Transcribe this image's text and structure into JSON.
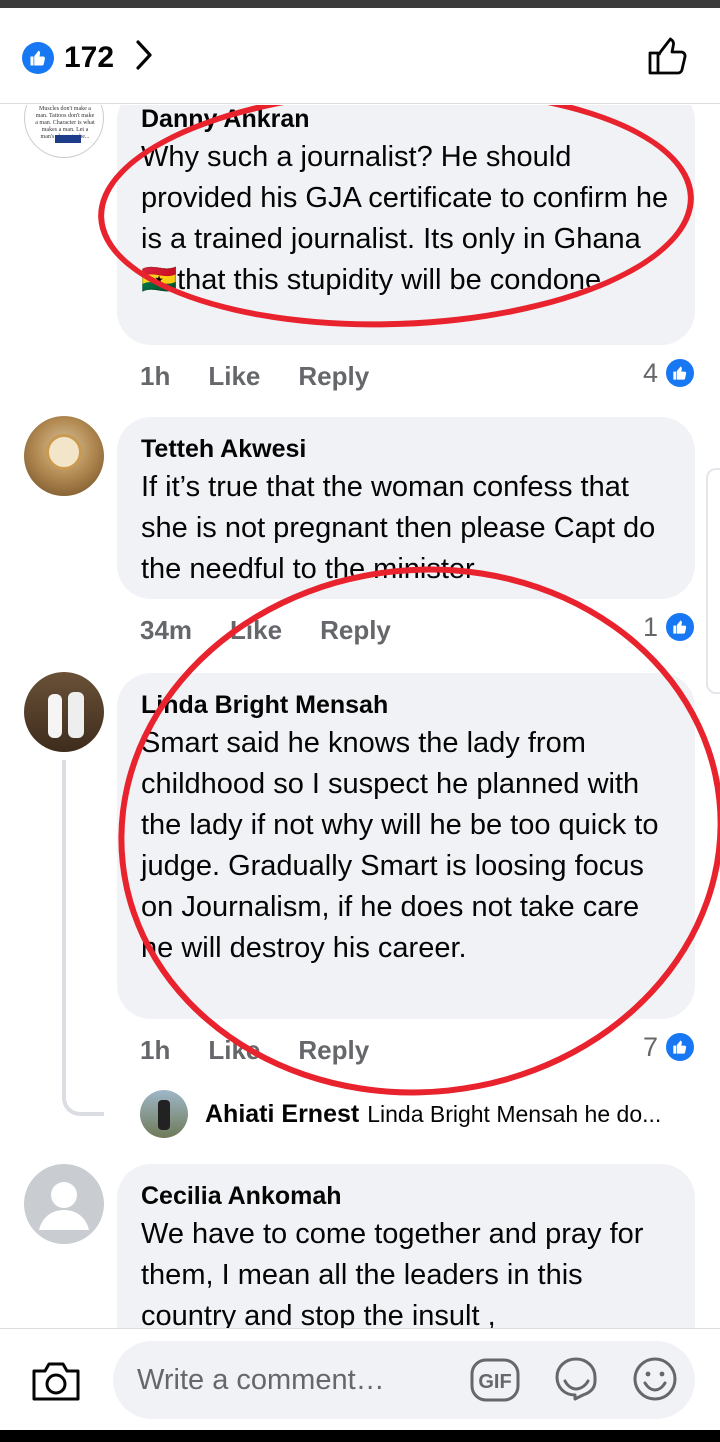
{
  "header": {
    "like_count": "172"
  },
  "comments": [
    {
      "author": "Danny Ankran",
      "avatar_text": "Muscles don't make a man. Tattoos don't make a man. Character is what makes a man. Let a man's character be...",
      "text": "Why such a journalist? He should provided his GJA certificate to confirm he is a trained journalist. Its only in Ghana 🇬🇭that this stupidity will be condone",
      "time": "1h",
      "like": "Like",
      "reply": "Reply",
      "reactions": "4"
    },
    {
      "author": "Tetteh Akwesi",
      "text": "If it’s true that the woman confess that she is not pregnant then please Capt do the needful to the minister",
      "time": "34m",
      "like": "Like",
      "reply": "Reply",
      "reactions": "1"
    },
    {
      "author": "Linda Bright Mensah",
      "text": "Smart said he knows the lady from childhood so I suspect he planned with the lady if not why will he be too quick to judge. Gradually Smart is loosing focus on Journalism, if he does not take care he will destroy his career.",
      "time": "1h",
      "like": "Like",
      "reply": "Reply",
      "reactions": "7",
      "reply_preview": {
        "author": "Ahiati Ernest",
        "snippet": "Linda Bright Mensah he do..."
      }
    },
    {
      "author": "Cecilia Ankomah",
      "text": "We  have to  come together and pray for them, I mean all the leaders in this country and stop the insult ,"
    }
  ],
  "composer": {
    "placeholder": "Write a comment…",
    "gif_label": "GIF"
  },
  "colors": {
    "accent": "#1877f2",
    "annotation": "#e8232d",
    "bubble": "#f0f2f5",
    "muted": "#65676b"
  }
}
